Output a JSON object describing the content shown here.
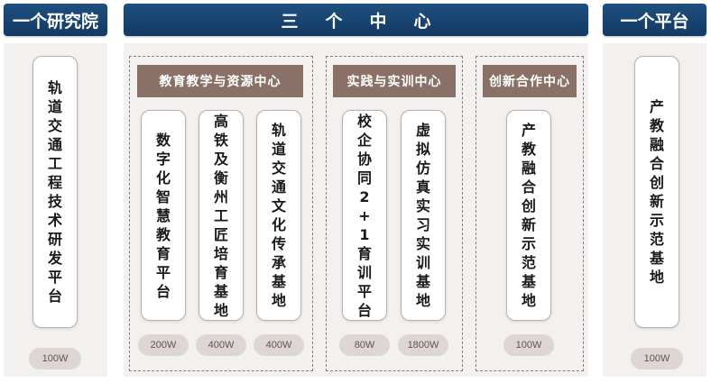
{
  "headers": {
    "left": "一个研究院",
    "center": "三个中心",
    "right": "一个平台"
  },
  "groups": {
    "g1": "教育教学与资源中心",
    "g2": "实践与实训中心",
    "g3": "创新合作中心"
  },
  "cards": {
    "research": "轨道交通工程技术研发平台",
    "digital": "数字化智慧教育平台",
    "rail": "高铁及衡州工匠培育基地",
    "culture": "轨道交通文化传承基地",
    "school": "校企协同2+1育训平台",
    "virtual": "虚拟仿真实习实训基地",
    "innovation": "产教融合创新示范基地",
    "platform": "产教融合创新示范基地"
  },
  "badges": {
    "research": "100W",
    "digital": "200W",
    "rail": "400W",
    "culture": "400W",
    "school": "80W",
    "virtual": "1800W",
    "innovation": "100W",
    "platform": "100W"
  }
}
